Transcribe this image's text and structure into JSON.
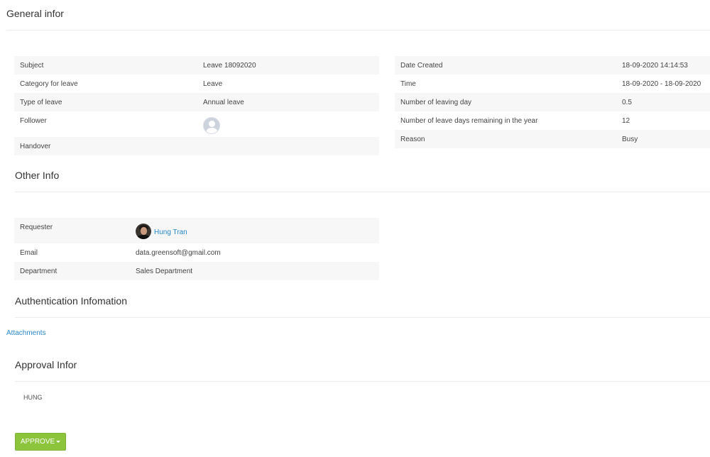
{
  "general": {
    "title": "General infor",
    "left_rows": [
      {
        "label": "Subject",
        "value": "Leave 18092020"
      },
      {
        "label": "Category for leave",
        "value": "Leave"
      },
      {
        "label": "Type of leave",
        "value": "Annual leave"
      },
      {
        "label": "Follower",
        "value": ""
      },
      {
        "label": "Handover",
        "value": ""
      }
    ],
    "right_rows": [
      {
        "label": "Date Created",
        "value": "18-09-2020 14:14:53"
      },
      {
        "label": "Time",
        "value": "18-09-2020 - 18-09-2020"
      },
      {
        "label": "Number of leaving day",
        "value": "0.5"
      },
      {
        "label": "Number of leave days remaining in the year",
        "value": "12"
      },
      {
        "label": "Reason",
        "value": "Busy"
      }
    ]
  },
  "other": {
    "title": "Other Info",
    "rows": [
      {
        "label": "Requester",
        "value": "Hung Tran"
      },
      {
        "label": "Email",
        "value": "data.greensoft@gmail.com"
      },
      {
        "label": "Department",
        "value": "Sales Department"
      }
    ]
  },
  "auth": {
    "title": "Authentication Infomation",
    "attachments_label": "Attachments"
  },
  "approval": {
    "title": "Approval Infor",
    "approver": "HUNG",
    "approve_label": "APPROVE"
  },
  "colors": {
    "accent": "#8cc43c",
    "link": "#2a87c8"
  }
}
